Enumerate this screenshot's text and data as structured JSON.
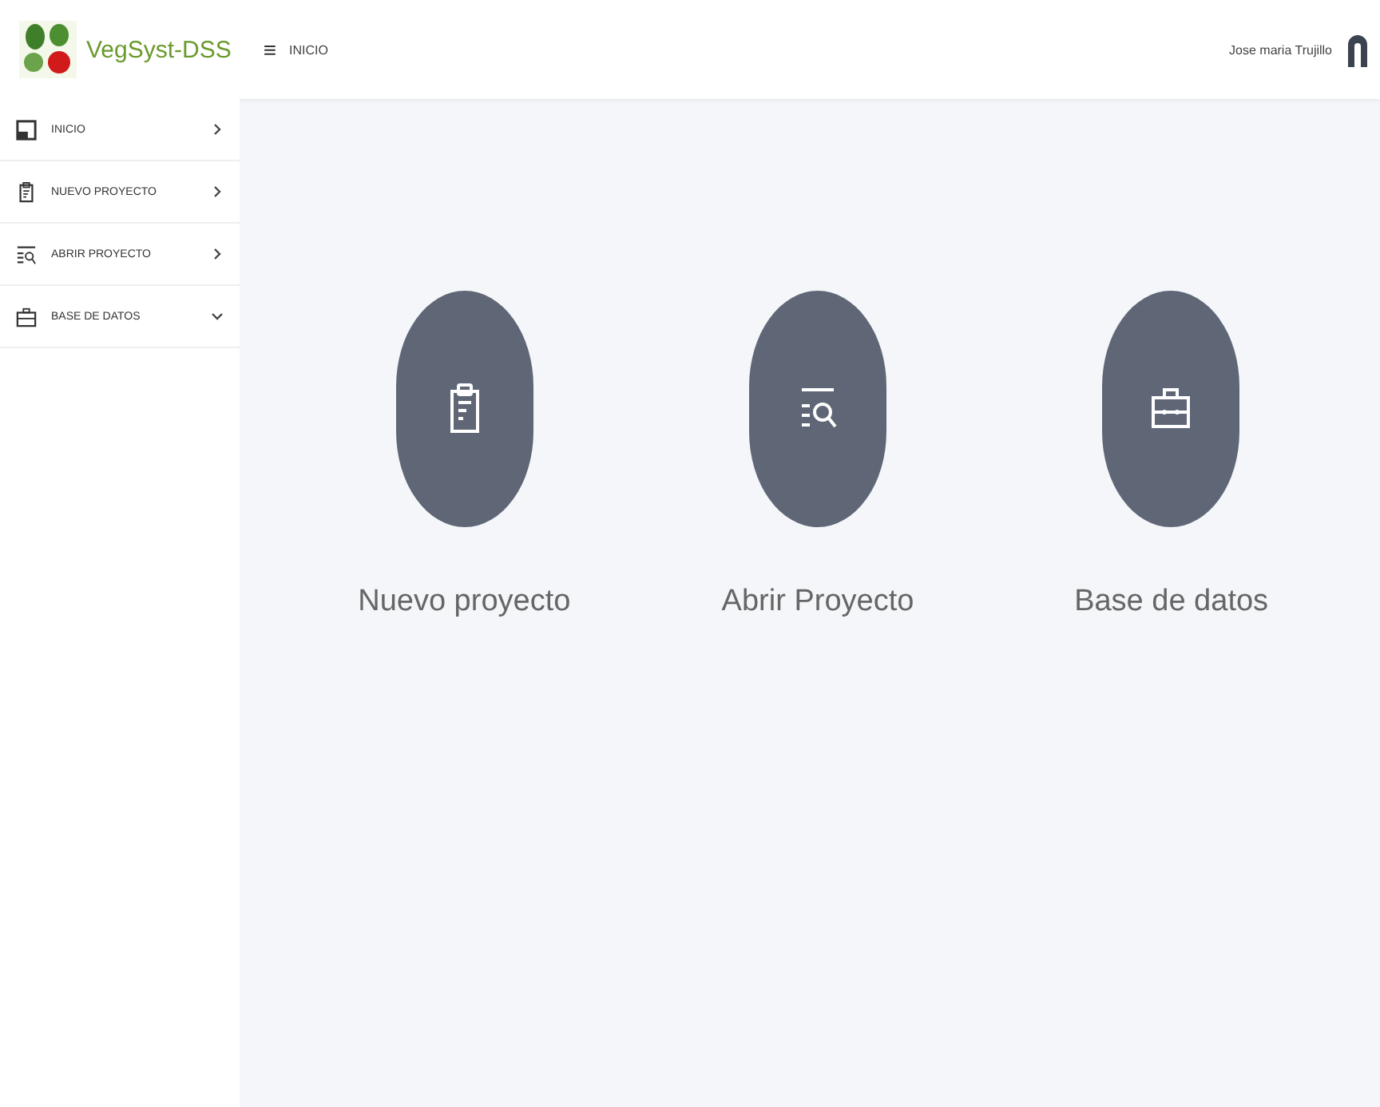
{
  "header": {
    "brand": "VegSyst-DSS",
    "menu_glyph": "≡",
    "breadcrumb": "INICIO",
    "user": "Jose maria Trujillo"
  },
  "sidebar": {
    "items": [
      {
        "label": "INICIO",
        "kind": "home",
        "expanded": false
      },
      {
        "label": "NUEVO PROYECTO",
        "kind": "clipboard",
        "expanded": false
      },
      {
        "label": "ABRIR PROYECTO",
        "kind": "search",
        "expanded": false
      },
      {
        "label": "BASE DE DATOS",
        "kind": "briefcase",
        "expanded": true
      }
    ]
  },
  "cards": [
    {
      "label": "Nuevo proyecto",
      "kind": "clipboard"
    },
    {
      "label": "Abrir Proyecto",
      "kind": "search"
    },
    {
      "label": "Base de datos",
      "kind": "briefcase"
    }
  ]
}
